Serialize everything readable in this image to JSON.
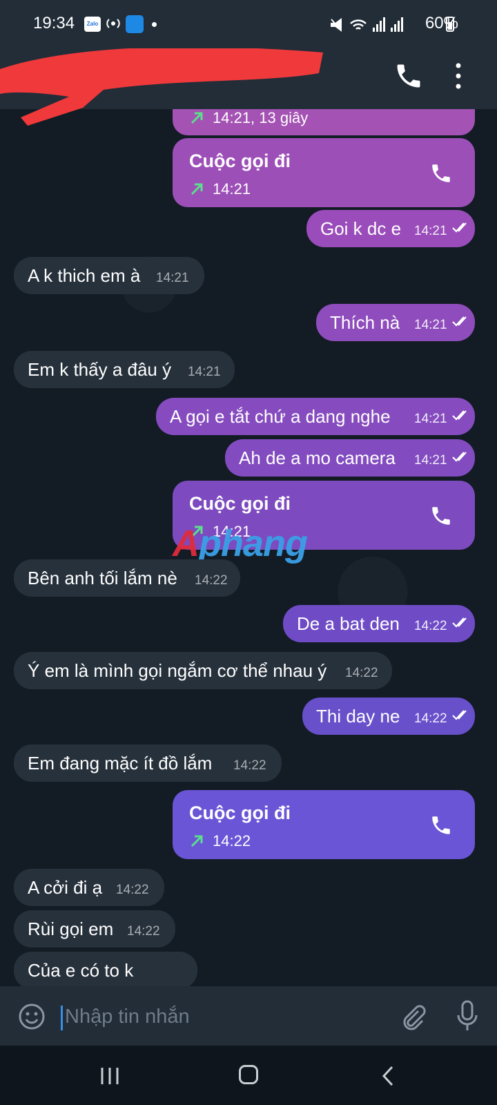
{
  "status_bar": {
    "time": "19:34",
    "zalo_label": "Zalo",
    "battery": "60%"
  },
  "header": {
    "call_icon": "phone-icon",
    "more_icon": "more-vertical-icon"
  },
  "messages": [
    {
      "kind": "call",
      "direction": "out",
      "title": "",
      "sub": "14:21, 13 giây",
      "color": "#a452b3"
    },
    {
      "kind": "call",
      "direction": "out",
      "title": "Cuộc gọi đi",
      "sub": "14:21",
      "color": "#9d4fb8"
    },
    {
      "kind": "text",
      "direction": "out",
      "text": "Goi k dc e",
      "time": "14:21"
    },
    {
      "kind": "text",
      "direction": "in",
      "text": "A k thich em à",
      "time": "14:21"
    },
    {
      "kind": "text",
      "direction": "out",
      "text": "Thích nà",
      "time": "14:21"
    },
    {
      "kind": "text",
      "direction": "in",
      "text": "Em k thấy a đâu ý",
      "time": "14:21"
    },
    {
      "kind": "text",
      "direction": "out",
      "text": "A gọi e tắt chứ a dang nghe",
      "time": "14:21"
    },
    {
      "kind": "text",
      "direction": "out",
      "text": "Ah de a mo camera",
      "time": "14:21"
    },
    {
      "kind": "call",
      "direction": "out",
      "title": "Cuộc gọi đi",
      "sub": "14:21",
      "color": "#7d4bbf"
    },
    {
      "kind": "text",
      "direction": "in",
      "text": "Bên anh tối lắm nè",
      "time": "14:22"
    },
    {
      "kind": "text",
      "direction": "out",
      "text": "De a bat den",
      "time": "14:22"
    },
    {
      "kind": "text",
      "direction": "in",
      "text": "Ý em là mình gọi ngắm cơ thể nhau ý",
      "time": "14:22"
    },
    {
      "kind": "text",
      "direction": "out",
      "text": "Thi day ne",
      "time": "14:22"
    },
    {
      "kind": "text",
      "direction": "in",
      "text": "Em đang mặc ít đồ lắm",
      "time": "14:22"
    },
    {
      "kind": "call",
      "direction": "out",
      "title": "Cuộc gọi đi",
      "sub": "14:22",
      "color": "#6a55d6"
    },
    {
      "kind": "text",
      "direction": "in",
      "text": "A cởi đi ạ",
      "time": "14:22"
    },
    {
      "kind": "text",
      "direction": "in",
      "text": "Rùi gọi em",
      "time": "14:22"
    },
    {
      "kind": "text",
      "direction": "in",
      "text": "Của e có to k",
      "time": ""
    }
  ],
  "watermark": {
    "part1": "A",
    "part2": "phang"
  },
  "input": {
    "placeholder": "Nhập tin nhắn"
  }
}
